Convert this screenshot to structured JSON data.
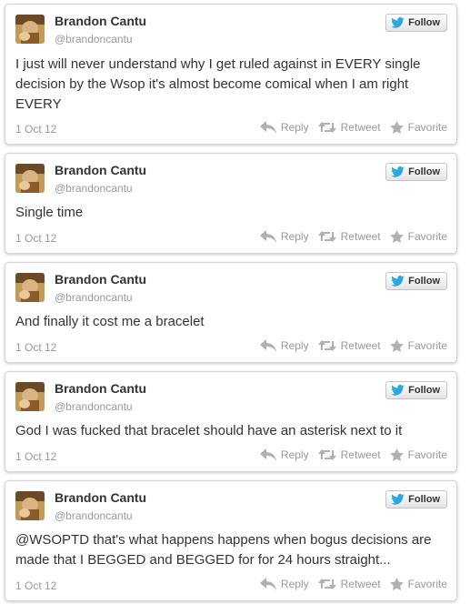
{
  "follow_label": "Follow",
  "actions": {
    "reply": "Reply",
    "retweet": "Retweet",
    "favorite": "Favorite"
  },
  "tweets": [
    {
      "name": "Brandon Cantu",
      "handle": "@brandoncantu",
      "text": "I just will never understand why I get ruled against in EVERY single decision by the Wsop it's almost become comical when I am right EVERY",
      "date": "1 Oct 12"
    },
    {
      "name": "Brandon Cantu",
      "handle": "@brandoncantu",
      "text": "Single time",
      "date": "1 Oct 12"
    },
    {
      "name": "Brandon Cantu",
      "handle": "@brandoncantu",
      "text": "And finally it cost me a bracelet",
      "date": "1 Oct 12"
    },
    {
      "name": "Brandon Cantu",
      "handle": "@brandoncantu",
      "text": "God I was fucked that bracelet should have an asterisk next to it",
      "date": "1 Oct 12"
    },
    {
      "name": "Brandon Cantu",
      "handle": "@brandoncantu",
      "text": "@WSOPTD that's what happens happens when bogus decisions are made that I BEGGED and BEGGED for for 24 hours straight...",
      "date": "1 Oct 12"
    }
  ],
  "colors": {
    "bird": "#2aa9e0",
    "text": "#333333",
    "muted": "#999999"
  }
}
